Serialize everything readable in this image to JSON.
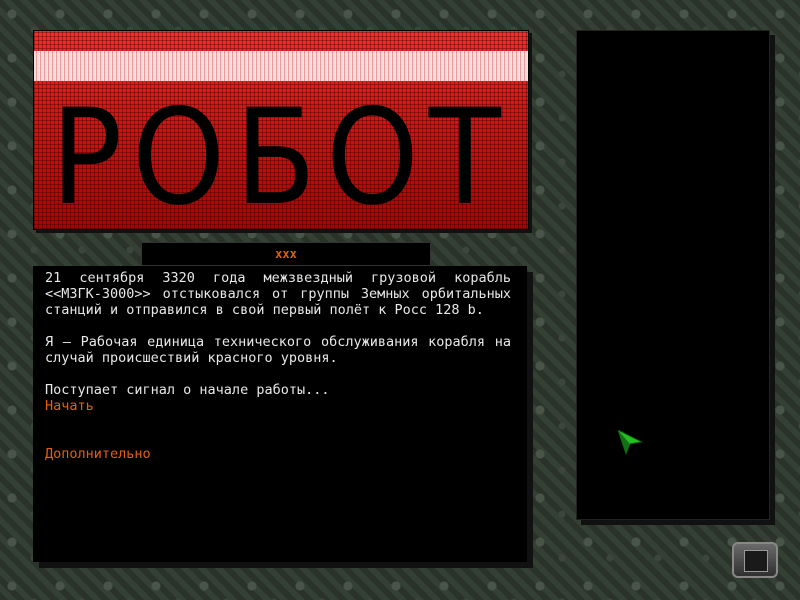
{
  "header": {
    "title": "РОБОТ",
    "tab_label": "xxx"
  },
  "story": {
    "paragraphs": [
      "21 сентября 3320 года межзвездный грузовой корабль <<МЗГК-3000>> отстыковался от группы Земных орбитальных станций и отправился в свой первый полёт к Росс 128 b.",
      "Я — Рабочая единица технического обслуживания корабля на случай происшествий красного уровня.",
      "Поступает сигнал о начале работы..."
    ],
    "start_label": "Начать",
    "extra_label": "Дополнительно"
  },
  "colors": {
    "accent": "#e06010",
    "banner_red": "#d41010",
    "cursor_green": "#22c022"
  },
  "icons": {
    "cursor": "arrow-cursor-icon",
    "corner": "menu-box-icon"
  }
}
